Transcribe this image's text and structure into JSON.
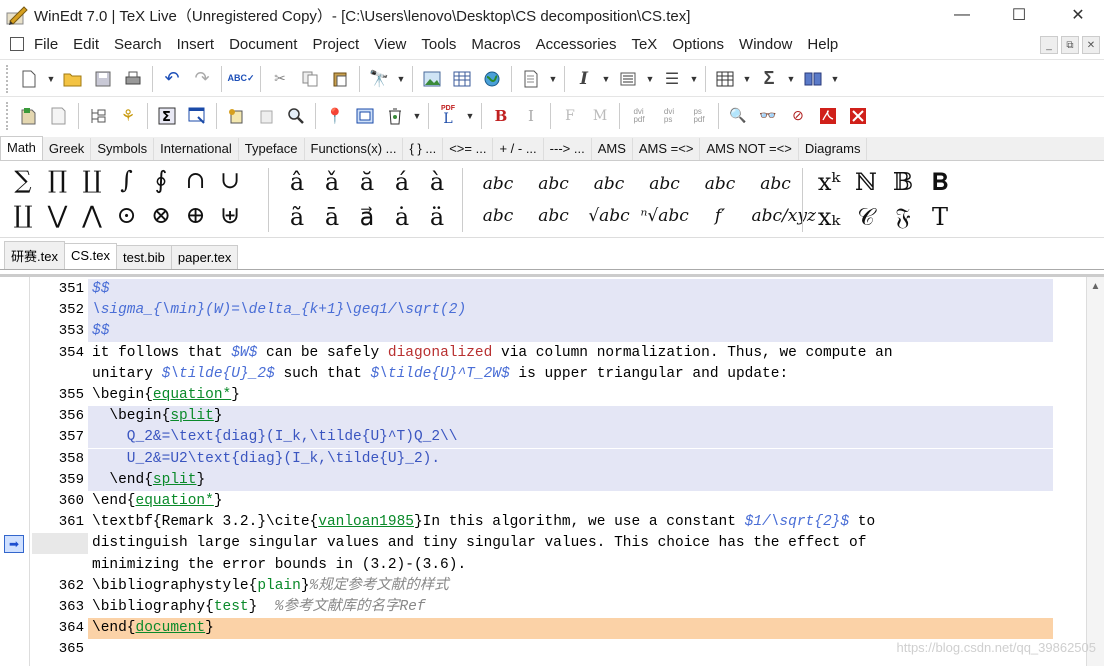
{
  "window": {
    "title": "WinEdt 7.0 | TeX Live（Unregistered Copy）- [C:\\Users\\lenovo\\Desktop\\CS decomposition\\CS.tex]",
    "min_glyph": "—",
    "max_glyph": "☐",
    "close_glyph": "✕"
  },
  "menu": [
    "File",
    "Edit",
    "Search",
    "Insert",
    "Document",
    "Project",
    "View",
    "Tools",
    "Macros",
    "Accessories",
    "TeX",
    "Options",
    "Window",
    "Help"
  ],
  "mdi": {
    "min": "_",
    "restore": "⧉",
    "close": "✕"
  },
  "palette_tabs": [
    "Math",
    "Greek",
    "Symbols",
    "International",
    "Typeface",
    "Functions(x) ...",
    "{ } ...",
    "<>= ...",
    "+ / - ...",
    "---> ...",
    "AMS",
    "AMS =<>",
    "AMS NOT =<>",
    "Diagrams"
  ],
  "palette": {
    "row1_symbols": [
      "∑",
      "∏",
      "∐",
      "∫",
      "∮",
      "∩",
      "∪"
    ],
    "row2_symbols": [
      "∐",
      "⋁",
      "⋀",
      "⊙",
      "⊗",
      "⊕",
      "⊎"
    ],
    "row1_accents": [
      "â",
      "ǎ",
      "ă",
      "á",
      "à"
    ],
    "row2_accents": [
      "ã",
      "ā",
      "a⃗",
      "ȧ",
      "ä"
    ],
    "row1_wide": [
      "abc",
      "abc",
      "abc",
      "abc",
      "abc",
      "abc"
    ],
    "row2_wide": [
      "abc",
      "abc",
      "√abc",
      "ⁿ√abc",
      "f′",
      "abc/xyz"
    ],
    "row1_misc": [
      "xᵏ",
      "ℕ",
      "𝔹",
      "𝐁"
    ],
    "row2_misc": [
      "xₖ",
      "𝒞",
      "𝔉",
      "T"
    ]
  },
  "file_tabs": [
    "研赛.tex",
    "CS.tex",
    "test.bib",
    "paper.tex"
  ],
  "editor": {
    "lines": [
      {
        "n": "351",
        "parts": [
          [
            "c-math",
            "$$"
          ]
        ],
        "hl": "hl"
      },
      {
        "n": "352",
        "parts": [
          [
            "c-math",
            "\\sigma_{\\min}(W)=\\delta_{k+1}\\geq1/\\sqrt(2)"
          ]
        ],
        "hl": "hl"
      },
      {
        "n": "353",
        "parts": [
          [
            "c-math",
            "$$"
          ]
        ],
        "hl": "hl"
      },
      {
        "n": "354",
        "parts": [
          [
            "",
            "it follows that "
          ],
          [
            "c-math",
            "$W$"
          ],
          [
            "",
            " can be safely "
          ],
          [
            "c-red",
            "diagonalized"
          ],
          [
            "",
            " via column normalization. Thus, we compute an"
          ]
        ],
        "hl": ""
      },
      {
        "n": "",
        "parts": [
          [
            "",
            "unitary "
          ],
          [
            "c-math",
            "$\\tilde{U}_2$"
          ],
          [
            "",
            " such that "
          ],
          [
            "c-math",
            "$\\tilde{U}^T_2W$"
          ],
          [
            "",
            " is upper triangular and update:"
          ]
        ],
        "hl": ""
      },
      {
        "n": "355",
        "parts": [
          [
            "",
            "\\begin{"
          ],
          [
            "c-arg",
            "equation*"
          ],
          [
            "",
            "}"
          ]
        ],
        "hl": ""
      },
      {
        "n": "356",
        "parts": [
          [
            "",
            "  \\begin{"
          ],
          [
            "c-arg",
            "split"
          ],
          [
            "",
            "}"
          ]
        ],
        "hl": "hl"
      },
      {
        "n": "357",
        "parts": [
          [
            "c-blu",
            "    Q_2&=\\text{diag}(I_k,\\tilde{U}^T)Q_2\\\\"
          ]
        ],
        "hl": "hl"
      },
      {
        "n": "358",
        "parts": [
          [
            "c-blu",
            "    U_2&=U2\\text{diag}(I_k,\\tilde{U}_2)."
          ]
        ],
        "hl": "hl"
      },
      {
        "n": "359",
        "parts": [
          [
            "",
            "  \\end{"
          ],
          [
            "c-arg",
            "split"
          ],
          [
            "",
            "}"
          ]
        ],
        "hl": "hl"
      },
      {
        "n": "360",
        "parts": [
          [
            "",
            "\\end{"
          ],
          [
            "c-arg",
            "equation*"
          ],
          [
            "",
            "}"
          ]
        ],
        "hl": ""
      },
      {
        "n": "361",
        "parts": [
          [
            "",
            "\\textbf{Remark 3.2.}\\cite{"
          ],
          [
            "c-arg",
            "vanloan1985"
          ],
          [
            "",
            "}In this algorithm, we use a constant "
          ],
          [
            "c-math",
            "$1/\\sqrt{2}$"
          ],
          [
            "",
            " to"
          ]
        ],
        "hl": ""
      },
      {
        "n": "",
        "parts": [
          [
            "",
            "distinguish large singular values and tiny singular values. This choice has the effect of"
          ]
        ],
        "hl": ""
      },
      {
        "n": "",
        "parts": [
          [
            "",
            "minimizing the error bounds in (3.2)-(3.6)."
          ]
        ],
        "hl": ""
      },
      {
        "n": "362",
        "parts": [
          [
            "",
            "\\bibliographystyle{"
          ],
          [
            "c-grn",
            "plain"
          ],
          [
            "",
            "}"
          ],
          [
            "c-cmt",
            "%规定参考文献的样式"
          ]
        ],
        "hl": ""
      },
      {
        "n": "363",
        "parts": [
          [
            "",
            "\\bibliography{"
          ],
          [
            "c-grn",
            "test"
          ],
          [
            "",
            "}  "
          ],
          [
            "c-cmt",
            "%参考文献库的名字Ref"
          ]
        ],
        "hl": ""
      },
      {
        "n": "364",
        "parts": [
          [
            "",
            "\\end{"
          ],
          [
            "c-arg",
            "document"
          ],
          [
            "",
            "}"
          ]
        ],
        "hl": "hlo"
      },
      {
        "n": "365",
        "parts": [],
        "hl": ""
      }
    ]
  },
  "watermark": "https://blog.csdn.net/qq_39862505"
}
